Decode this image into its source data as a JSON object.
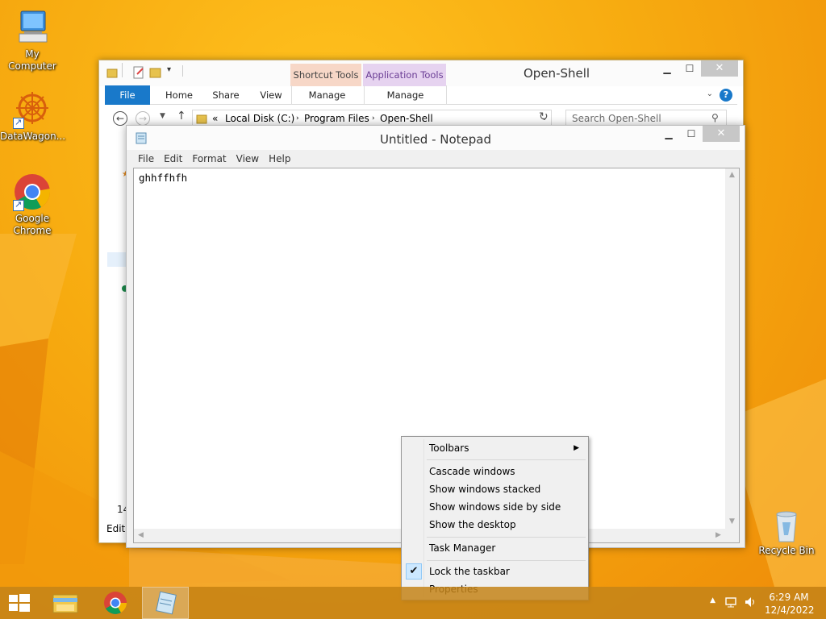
{
  "desktop": {
    "icons": [
      {
        "label": "My Computer",
        "icon": "computer-icon"
      },
      {
        "label": "DataWagon...",
        "icon": "datawagon-icon"
      },
      {
        "label": "Google Chrome",
        "icon": "chrome-icon"
      },
      {
        "label": "Recycle Bin",
        "icon": "recycle-bin-icon"
      }
    ]
  },
  "explorer": {
    "title": "Open-Shell",
    "contextual_tabs": {
      "shortcut_tools": "Shortcut Tools",
      "application_tools": "Application Tools"
    },
    "ribbon_tabs": [
      "File",
      "Home",
      "Share",
      "View",
      "Manage",
      "Manage"
    ],
    "address": {
      "prefix": "«",
      "crumbs": [
        "Local Disk (C:)",
        "Program Files",
        "Open-Shell"
      ]
    },
    "search_placeholder": "Search Open-Shell",
    "status_partial": "14",
    "menu_partial": "Edit"
  },
  "notepad": {
    "title": "Untitled - Notepad",
    "menus": [
      "File",
      "Edit",
      "Format",
      "View",
      "Help"
    ],
    "content": "ghhffhfh"
  },
  "context_menu": {
    "items": [
      {
        "label": "Toolbars",
        "submenu": true
      },
      {
        "label": "Cascade windows"
      },
      {
        "label": "Show windows stacked"
      },
      {
        "label": "Show windows side by side"
      },
      {
        "label": "Show the desktop"
      },
      {
        "label": "Task Manager"
      },
      {
        "label": "Lock the taskbar",
        "checked": true
      },
      {
        "label": "Properties"
      }
    ]
  },
  "taskbar": {
    "time": "6:29 AM",
    "date": "12/4/2022",
    "pinned": [
      "file-explorer-icon",
      "chrome-icon",
      "notepad-icon"
    ]
  },
  "colors": {
    "accent_file_tab": "#1979ca",
    "desktop_orange": "#f7ab10",
    "shortcut_tools_tab": "#f7d7c7",
    "application_tools_tab": "#e6d3f0"
  }
}
